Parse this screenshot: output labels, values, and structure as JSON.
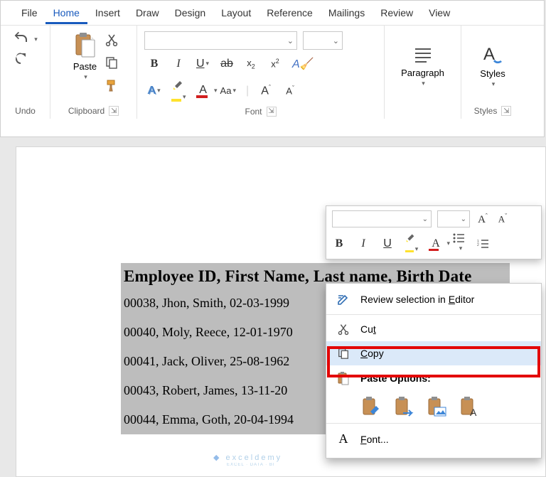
{
  "tabs": [
    "File",
    "Home",
    "Insert",
    "Draw",
    "Design",
    "Layout",
    "Reference",
    "Mailings",
    "Review",
    "View"
  ],
  "groups": {
    "undo": "Undo",
    "clipboard": "Clipboard",
    "font": "Font",
    "paragraph": "Paragraph",
    "styles": "Styles"
  },
  "paste": "Paste",
  "para": "Paragraph",
  "sty": "Styles",
  "font_buttons": {
    "bold": "B",
    "italic": "I",
    "underline": "U",
    "strike": "ab",
    "sub": "x",
    "sup": "x",
    "textfx": "A",
    "highlight": "",
    "fontcolor": "A",
    "case": "Aa",
    "grow": "A",
    "shrink": "A"
  },
  "doc": {
    "header": "Employee ID, First Name, Last name, Birth Date",
    "lines": [
      "00038, Jhon, Smith, 02-03-1999",
      "00040, Moly, Reece, 12-01-1970",
      "00041, Jack, Oliver, 25-08-1962",
      "00043, Robert, James, 13-11-20",
      "00044, Emma, Goth, 20-04-1994"
    ]
  },
  "mini": {
    "bold": "B",
    "italic": "I",
    "underline": "U"
  },
  "ctx": {
    "review_pre": "Review selection in ",
    "review_acc": "E",
    "review_post": "ditor",
    "cut": "Cu",
    "cut_acc": "t",
    "copy_acc": "C",
    "copy_post": "opy",
    "pasteopt": "Paste Options:",
    "font_acc": "F",
    "font_post": "ont..."
  },
  "watermark": "exceldemy",
  "watermark_sub": "EXCEL · DATA · BI"
}
